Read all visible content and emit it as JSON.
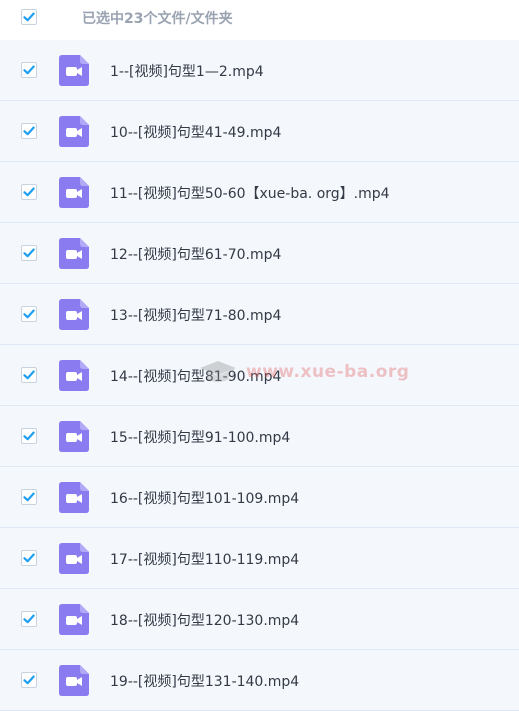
{
  "header": {
    "select_all_checked": true,
    "selection_text": "已选中23个文件/文件夹"
  },
  "icons": {
    "checkbox": "checkbox-checked-icon",
    "file": "video-file-icon"
  },
  "colors": {
    "checkbox_blue": "#1f9ff2",
    "video_icon_purple": "#8a7cf0",
    "row_background": "#f4f8fd",
    "row_border": "#dfe9f5"
  },
  "files": [
    {
      "name": "1--[视频]句型1—2.mp4",
      "checked": true
    },
    {
      "name": "10--[视频]句型41-49.mp4",
      "checked": true
    },
    {
      "name": "11--[视频]句型50-60【xue-ba. org】.mp4",
      "checked": true
    },
    {
      "name": "12--[视频]句型61-70.mp4",
      "checked": true
    },
    {
      "name": "13--[视频]句型71-80.mp4",
      "checked": true
    },
    {
      "name": "14--[视频]句型81-90.mp4",
      "checked": true
    },
    {
      "name": "15--[视频]句型91-100.mp4",
      "checked": true
    },
    {
      "name": "16--[视频]句型101-109.mp4",
      "checked": true
    },
    {
      "name": "17--[视频]句型110-119.mp4",
      "checked": true
    },
    {
      "name": "18--[视频]句型120-130.mp4",
      "checked": true
    },
    {
      "name": "19--[视频]句型131-140.mp4",
      "checked": true
    }
  ],
  "watermark": {
    "text": "www.xue-ba.org"
  }
}
